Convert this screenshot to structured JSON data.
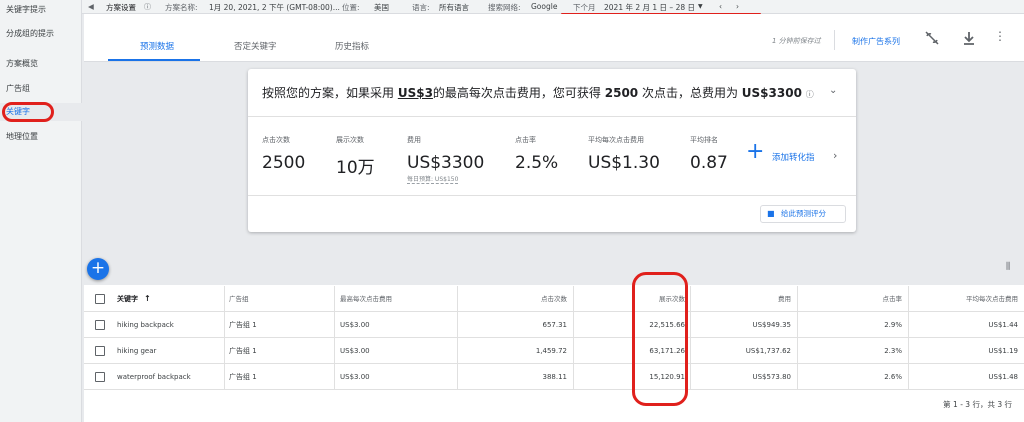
{
  "sidebar": {
    "items": [
      {
        "label": "关键字提示"
      },
      {
        "label": "分成组的提示"
      },
      {
        "label": "方案概览"
      },
      {
        "label": "广告组"
      },
      {
        "label": "关键字",
        "active": true
      },
      {
        "label": "地理位置"
      }
    ]
  },
  "topbar": {
    "settings_label": "方案设置",
    "name_label": "方案名称:",
    "name_value": "1月 20, 2021, 2 下午 (GMT-08:00)...",
    "location_label": "位置:",
    "location_value": "美国",
    "language_label": "语言:",
    "language_value": "所有语言",
    "network_label": "搜索网络:",
    "network_value": "Google",
    "period_label": "下个月",
    "period_value": "2021 年 2 月 1 日 – 28 日"
  },
  "toolbar": {
    "saved_text": "1 分钟前保存过",
    "create_campaign": "制作广告系列"
  },
  "tabs": [
    {
      "label": "预测数据",
      "active": true
    },
    {
      "label": "否定关键字"
    },
    {
      "label": "历史指标"
    }
  ],
  "forecast": {
    "headline_pre": "按照您的方案，如果采用 ",
    "headline_bid": "US$3",
    "headline_mid": "的最高每次点击费用，您可获得 ",
    "headline_clicks": "2500",
    "headline_mid2": " 次点击，总费用为 ",
    "headline_cost": "US$3300",
    "metrics": [
      {
        "label": "点击次数",
        "value": "2500"
      },
      {
        "label": "展示次数",
        "value": "10万"
      },
      {
        "label": "费用",
        "value": "US$3300",
        "sub": "每日预算: US$150"
      },
      {
        "label": "点击率",
        "value": "2.5%"
      },
      {
        "label": "平均每次点击费用",
        "value": "US$1.30"
      },
      {
        "label": "平均排名",
        "value": "0.87"
      }
    ],
    "add_conversion": "添加转化指",
    "rate_button": "给此预测评分"
  },
  "table": {
    "headers": [
      "关键字",
      "广告组",
      "最高每次点击费用",
      "点击次数",
      "展示次数",
      "费用",
      "点击率",
      "平均每次点击费用"
    ],
    "rows": [
      [
        "hiking backpack",
        "广告组 1",
        "US$3.00",
        "657.31",
        "22,515.66",
        "US$949.35",
        "2.9%",
        "US$1.44"
      ],
      [
        "hiking gear",
        "广告组 1",
        "US$3.00",
        "1,459.72",
        "63,171.26",
        "US$1,737.62",
        "2.3%",
        "US$1.19"
      ],
      [
        "waterproof backpack",
        "广告组 1",
        "US$3.00",
        "388.11",
        "15,120.91",
        "US$573.80",
        "2.6%",
        "US$1.48"
      ]
    ],
    "footer": "第 1 - 3 行，共 3 行"
  },
  "colors": {
    "accent": "#1a73e8",
    "highlight": "#e0201c"
  }
}
